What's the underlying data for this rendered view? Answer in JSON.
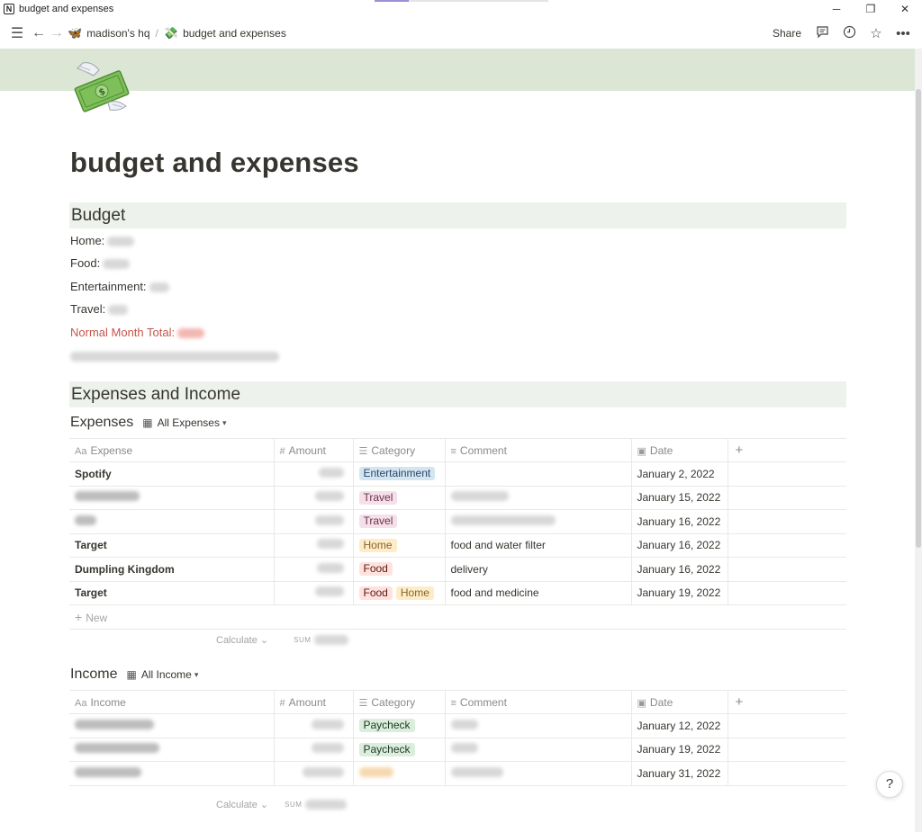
{
  "window": {
    "title": "budget and expenses",
    "app_icon_letter": "N",
    "controls": [
      "─",
      "❐",
      "✕"
    ]
  },
  "nav": {
    "breadcrumbs": [
      {
        "icon": "🦋",
        "label": "madison's hq"
      },
      {
        "icon": "💸",
        "label": "budget and expenses"
      }
    ],
    "share_label": "Share"
  },
  "page": {
    "title": "budget and expenses",
    "cover_color": "#dbe7d4",
    "heading_bg": "#edf3ec"
  },
  "budget": {
    "heading": "Budget",
    "lines": [
      {
        "label": "Home:"
      },
      {
        "label": "Food:"
      },
      {
        "label": "Entertainment:"
      },
      {
        "label": "Travel:"
      },
      {
        "label": "Normal Month Total:",
        "color": "#c4554d"
      }
    ]
  },
  "expenses_income_heading": "Expenses and Income",
  "expenses": {
    "title": "Expenses",
    "view_label": "All Expenses",
    "columns": [
      "Expense",
      "Amount",
      "Category",
      "Comment",
      "Date"
    ],
    "rows": [
      {
        "name": "Spotify",
        "tags": [
          {
            "label": "Entertainment",
            "bg": "#d3e5ef",
            "fg": "#28456c"
          }
        ],
        "comment": "",
        "date": "January 2, 2022"
      },
      {
        "name": "",
        "tags": [
          {
            "label": "Travel",
            "bg": "#f5e0e9",
            "fg": "#69314c"
          }
        ],
        "comment": "",
        "date": "January 15, 2022"
      },
      {
        "name": "",
        "tags": [
          {
            "label": "Travel",
            "bg": "#f5e0e9",
            "fg": "#69314c"
          }
        ],
        "comment": "",
        "date": "January 16, 2022"
      },
      {
        "name": "Target",
        "tags": [
          {
            "label": "Home",
            "bg": "#fdecc8",
            "fg": "#89632a"
          }
        ],
        "comment": "food and water filter",
        "date": "January 16, 2022"
      },
      {
        "name": "Dumpling Kingdom",
        "tags": [
          {
            "label": "Food",
            "bg": "#ffe2dd",
            "fg": "#5d1715"
          }
        ],
        "comment": "delivery",
        "date": "January 16, 2022"
      },
      {
        "name": "Target",
        "tags": [
          {
            "label": "Food",
            "bg": "#ffe2dd",
            "fg": "#5d1715"
          },
          {
            "label": "Home",
            "bg": "#fdecc8",
            "fg": "#89632a"
          }
        ],
        "comment": "food and medicine",
        "date": "January 19, 2022"
      }
    ],
    "new_label": "New",
    "calculate_label": "Calculate",
    "sum_label": "SUM"
  },
  "income": {
    "title": "Income",
    "view_label": "All Income",
    "columns": [
      "Income",
      "Amount",
      "Category",
      "Comment",
      "Date"
    ],
    "rows": [
      {
        "tags": [
          {
            "label": "Paycheck",
            "bg": "#dbeddb",
            "fg": "#1c3829"
          }
        ],
        "date": "January 12, 2022"
      },
      {
        "tags": [
          {
            "label": "Paycheck",
            "bg": "#dbeddb",
            "fg": "#1c3829"
          }
        ],
        "date": "January 19, 2022"
      },
      {
        "tags": [],
        "date": "January 31, 2022"
      }
    ],
    "calculate_label": "Calculate",
    "sum_label": "SUM"
  },
  "help_label": "?"
}
